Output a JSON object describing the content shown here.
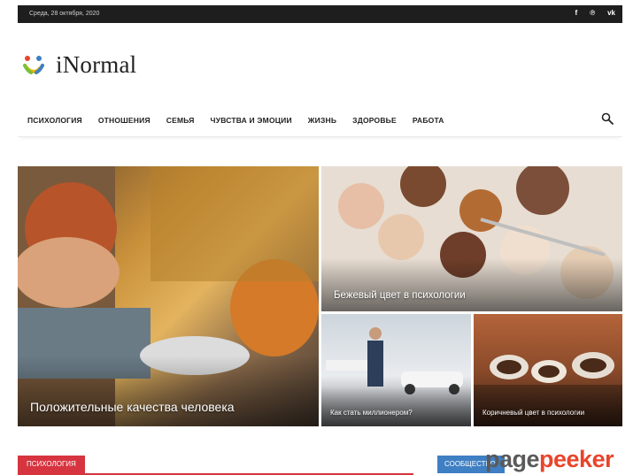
{
  "topbar": {
    "date": "Среда, 28 октября, 2020",
    "socials": [
      {
        "icon": "facebook-icon",
        "glyph": "f"
      },
      {
        "icon": "pinterest-icon",
        "glyph": "℗"
      },
      {
        "icon": "vk-icon",
        "glyph": "vk"
      }
    ]
  },
  "logo": {
    "name": "iNormal"
  },
  "nav": {
    "items": [
      "Психология",
      "Отношения",
      "Семья",
      "Чувства и эмоции",
      "Жизнь",
      "Здоровье",
      "Работа"
    ],
    "search_icon": "search-icon"
  },
  "featured": [
    {
      "title": "Положительные качества человека"
    },
    {
      "title": "Бежевый цвет в психологии"
    },
    {
      "title": "Как стать миллионером?"
    },
    {
      "title": "Коричневый цвет в психологии"
    }
  ],
  "sections": {
    "left": "Психология",
    "right": "Сообщество"
  },
  "watermark": {
    "part1": "page",
    "part2": "peeker"
  },
  "colors": {
    "accent_red": "#d6343f",
    "accent_blue": "#3f7fc4",
    "topbar": "#1e1e1e"
  }
}
